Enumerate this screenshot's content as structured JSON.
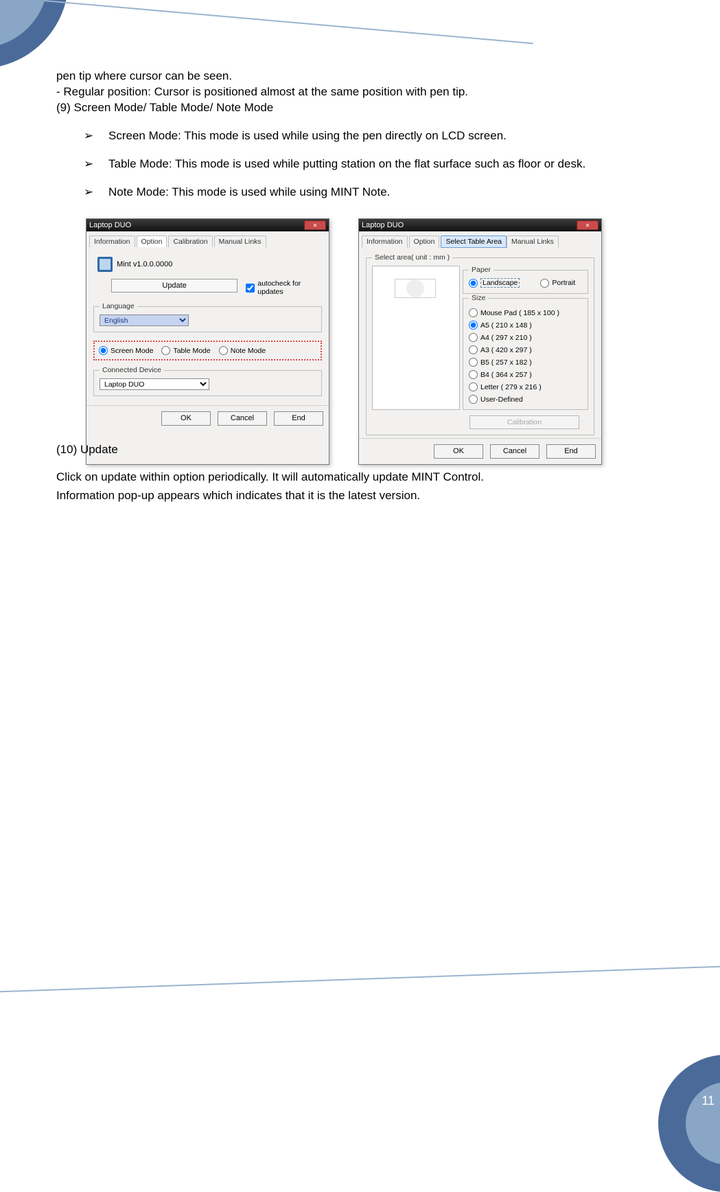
{
  "page_number": "11",
  "text": {
    "pen_tip": "pen tip where cursor can be seen.",
    "regular_prefix": "-  Regular position: Cursor is positioned almost at the same position with pen tip.",
    "section9": "(9) Screen Mode/ Table Mode/ Note Mode",
    "screen_mode": "Screen Mode: This mode is used while using the pen directly on LCD screen.",
    "table_mode": "Table Mode: This mode is used while putting station on the flat surface such as floor or desk.",
    "note_mode": "Note Mode: This mode is used while using MINT Note.",
    "section10": "(10) Update",
    "update1": "Click on update within option periodically. It will automatically update MINT Control.",
    "update2": "Information pop-up appears which indicates that it is the latest version."
  },
  "bullet_glyph": "➢",
  "dialog1": {
    "title": "Laptop DUO",
    "tabs": [
      "Information",
      "Option",
      "Calibration",
      "Manual Links"
    ],
    "active_tab": "Option",
    "version": "Mint v1.0.0.0000",
    "update_btn": "Update",
    "autocheck": "autocheck for updates",
    "language_legend": "Language",
    "language_value": "English",
    "modes": {
      "screen": "Screen Mode",
      "table": "Table Mode",
      "note": "Note Mode"
    },
    "device_legend": "Connected Device",
    "device_value": "Laptop DUO",
    "buttons": {
      "ok": "OK",
      "cancel": "Cancel",
      "end": "End"
    }
  },
  "dialog2": {
    "title": "Laptop DUO",
    "tabs_left": [
      "Information",
      "Option"
    ],
    "tab_sel": "Select Table Area",
    "tabs_right": [
      "Manual Links"
    ],
    "legend_area": "Select area( unit : mm )",
    "paper_legend": "Paper",
    "paper_landscape": "Landscape",
    "paper_portrait": "Portrait",
    "size_legend": "Size",
    "sizes": [
      "Mouse Pad ( 185 x 100 )",
      "A5 (  210 x 148  )",
      "A4 (  297 x 210  )",
      "A3 (  420 x 297  )",
      "B5 (  257 x 182  )",
      "B4 (  364 x 257  )",
      "Letter (  279 x 216  )",
      "User-Defined"
    ],
    "selected_size_index": 1,
    "calibrate": "Calibration",
    "buttons": {
      "ok": "OK",
      "cancel": "Cancel",
      "end": "End"
    }
  }
}
